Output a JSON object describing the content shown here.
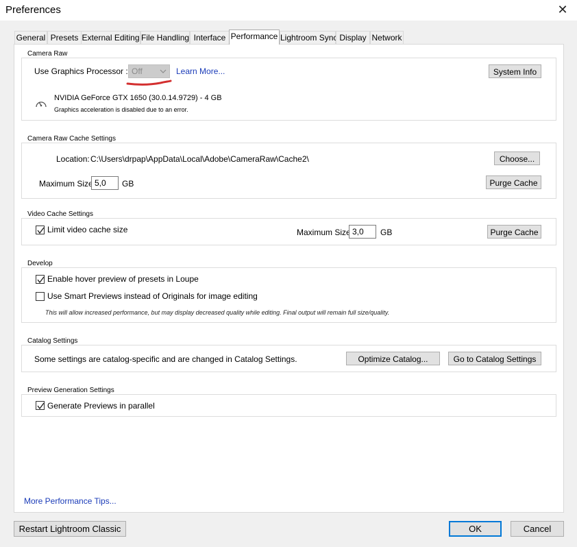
{
  "window": {
    "title": "Preferences",
    "close_glyph": "✕"
  },
  "tabs": [
    {
      "label": "General"
    },
    {
      "label": "Presets"
    },
    {
      "label": "External Editing"
    },
    {
      "label": "File Handling"
    },
    {
      "label": "Interface"
    },
    {
      "label": "Performance",
      "active": true
    },
    {
      "label": "Lightroom Sync"
    },
    {
      "label": "Display"
    },
    {
      "label": "Network"
    }
  ],
  "camera_raw": {
    "group_label": "Camera Raw",
    "gpu_label": "Use Graphics Processor :",
    "gpu_value": "Off",
    "learn_more": "Learn More...",
    "system_info": "System Info",
    "gpu_name": "NVIDIA GeForce GTX 1650 (30.0.14.9729) - 4 GB",
    "gpu_status": "Graphics acceleration is disabled due to an error.",
    "gpu_icon": "gauge-icon",
    "annotation_color": "#d32f2f"
  },
  "cache": {
    "group_label": "Camera Raw Cache Settings",
    "location_label": "Location:",
    "location_value": "C:\\Users\\drpap\\AppData\\Local\\Adobe\\CameraRaw\\Cache2\\",
    "choose": "Choose...",
    "max_size_label": "Maximum Size:",
    "max_size_value": "5,0",
    "unit": "GB",
    "purge": "Purge Cache"
  },
  "video_cache": {
    "group_label": "Video Cache Settings",
    "limit_label": "Limit video cache size",
    "limit_checked": true,
    "max_size_label": "Maximum Size:",
    "max_size_value": "3,0",
    "unit": "GB",
    "purge": "Purge Cache"
  },
  "develop": {
    "group_label": "Develop",
    "hover_label": "Enable hover preview of presets in Loupe",
    "hover_checked": true,
    "smart_label": "Use Smart Previews instead of Originals for image editing",
    "smart_checked": false,
    "note": "This will allow increased performance, but may display decreased quality while editing. Final output will remain full size/quality."
  },
  "catalog": {
    "group_label": "Catalog Settings",
    "text": "Some settings are catalog-specific and are changed in Catalog Settings.",
    "optimize": "Optimize Catalog...",
    "goto": "Go to Catalog Settings"
  },
  "preview_gen": {
    "group_label": "Preview Generation Settings",
    "parallel_label": "Generate Previews in parallel",
    "parallel_checked": true
  },
  "footer": {
    "tips_link": "More Performance Tips...",
    "restart": "Restart Lightroom Classic",
    "ok": "OK",
    "cancel": "Cancel"
  }
}
